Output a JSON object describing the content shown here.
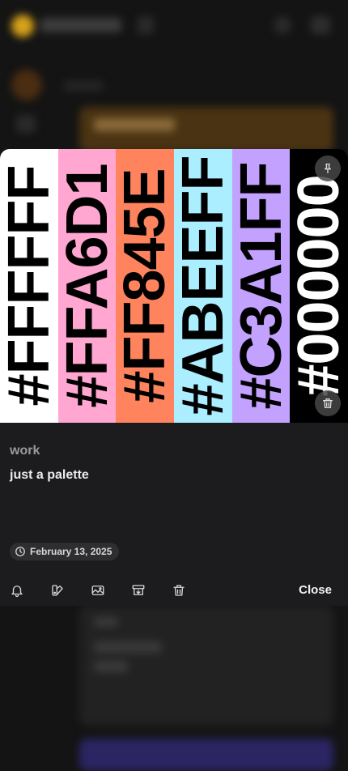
{
  "palette": {
    "swatches": [
      {
        "code": "#FFFFFF",
        "color": "#FFFFFF",
        "text_color": "#000000"
      },
      {
        "code": "#FFA6D1",
        "color": "#FFA6D1",
        "text_color": "#000000"
      },
      {
        "code": "#FF845E",
        "color": "#FF845E",
        "text_color": "#000000"
      },
      {
        "code": "#ABEEFF",
        "color": "#ABEEFF",
        "text_color": "#000000"
      },
      {
        "code": "#C3A1FF",
        "color": "#C3A1FF",
        "text_color": "#000000"
      },
      {
        "code": "#000000",
        "color": "#000000",
        "text_color": "#FFFFFF"
      }
    ]
  },
  "note": {
    "tag": "work",
    "text": "just a palette",
    "date": "February 13, 2025"
  },
  "toolbar": {
    "icons": [
      "bell-icon",
      "palette-icon",
      "image-icon",
      "archive-icon",
      "trash-icon"
    ],
    "close_label": "Close"
  },
  "icons": {
    "pin": "pin-icon",
    "delete_image": "trash-icon",
    "date": "clock-icon"
  },
  "colors": {
    "card_bg": "#1c1c1e",
    "page_bg": "#141414",
    "tag_text": "#9a9a9a"
  }
}
